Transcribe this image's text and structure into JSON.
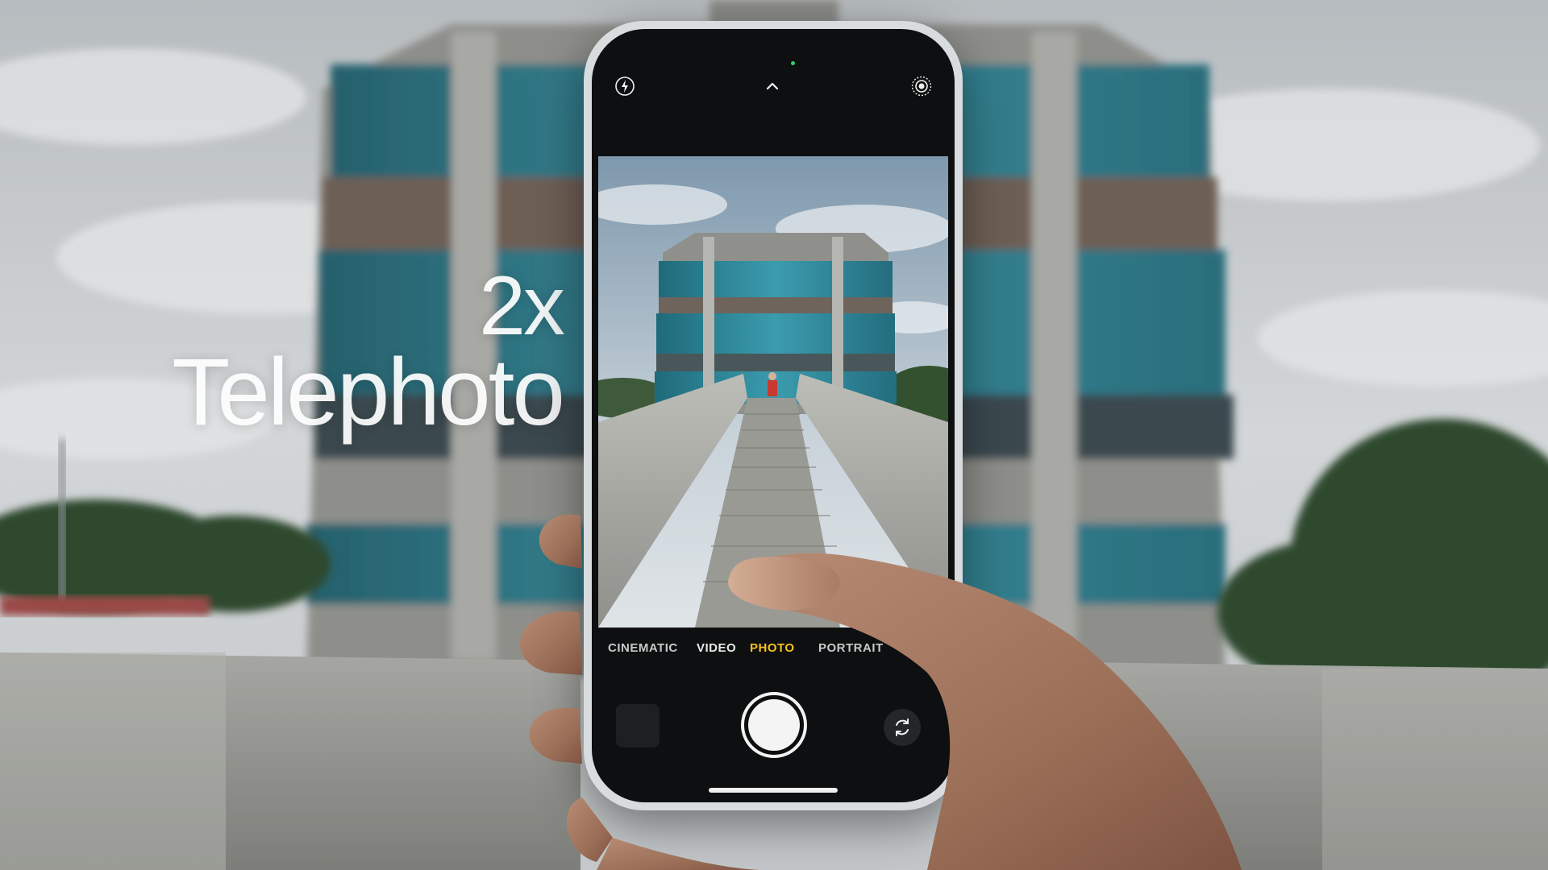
{
  "overlay": {
    "zoom": "2x",
    "lens": "Telephoto"
  },
  "camera": {
    "modes": [
      "CINEMATIC",
      "VIDEO",
      "PHOTO",
      "PORTRAIT"
    ],
    "selected_mode": "PHOTO",
    "selected_color": "#f7c21c",
    "icons": {
      "flash": "flash-icon",
      "controls": "chevron-up-icon",
      "live": "live-photo-icon",
      "flip": "camera-flip-icon"
    }
  },
  "colors": {
    "sky": "#c9cdd0",
    "glass": "#2e7f90",
    "concrete": "#9a9b96"
  }
}
